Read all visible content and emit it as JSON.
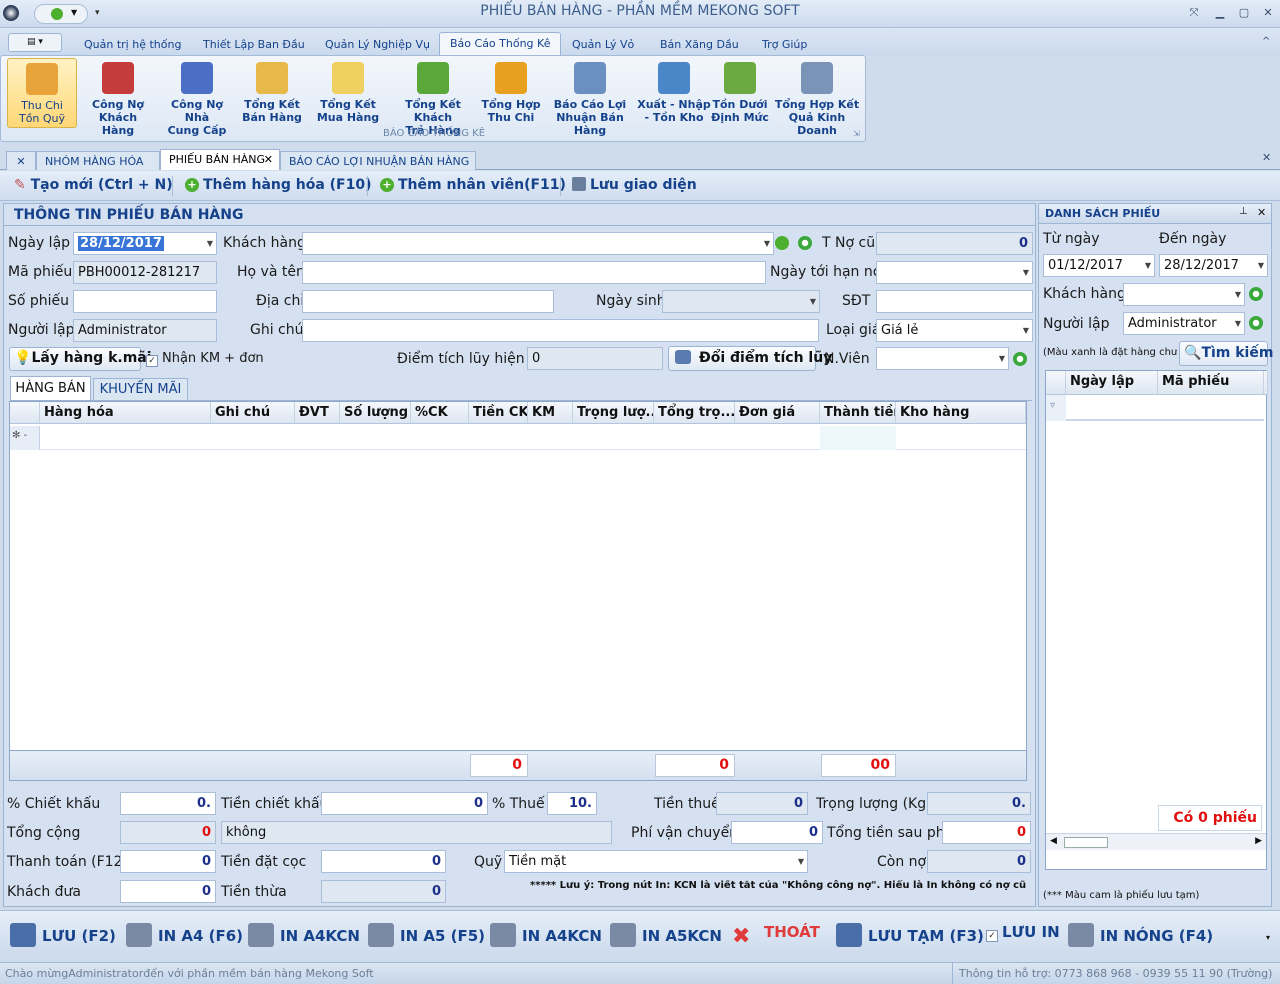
{
  "title": "PHIẾU BÁN HÀNG - PHẦN MỀM MEKONG SOFT",
  "menu": [
    "Quản trị hệ thống",
    "Thiết Lập Ban Đầu",
    "Quản Lý Nghiệp Vụ",
    "Báo Cáo Thống Kê",
    "Quản Lý Vỏ",
    "Bán Xăng Dầu",
    "Trợ Giúp"
  ],
  "ribbon": {
    "buttons": [
      {
        "line1": "Thu Chi",
        "line2": "Tồn Quỹ",
        "color": "#e8a33a"
      },
      {
        "line1": "Công Nợ",
        "line2": "Khách Hàng",
        "color": "#c63b3b"
      },
      {
        "line1": "Công Nợ Nhà",
        "line2": "Cung Cấp",
        "color": "#4b6fc4"
      },
      {
        "line1": "Tổng Kết",
        "line2": "Bán Hàng",
        "color": "#e7b84a"
      },
      {
        "line1": "Tổng Kết",
        "line2": "Mua Hàng",
        "color": "#f0d060"
      },
      {
        "line1": "Tổng Kết Khách",
        "line2": "Trả Hàng",
        "color": "#5aa83a"
      },
      {
        "line1": "Tổng Hợp",
        "line2": "Thu Chi",
        "color": "#e8a020"
      },
      {
        "line1": "Báo Cáo Lợi",
        "line2": "Nhuận Bán Hàng",
        "color": "#6a8fc0"
      },
      {
        "line1": "Xuất - Nhập",
        "line2": "- Tồn Kho",
        "color": "#4a86c8"
      },
      {
        "line1": "Tồn Dưới",
        "line2": "Định Mức",
        "color": "#6aaa40"
      },
      {
        "line1": "Tổng Hợp Kết",
        "line2": "Quả Kinh Doanh",
        "color": "#7a94b8"
      }
    ],
    "group_label": "BÁO CÁO THỐNG KÊ"
  },
  "doc_tabs": [
    "NHÓM HÀNG HÓA",
    "PHIẾU BÁN HÀNG",
    "BÁO CÁO LỢI NHUẬN BÁN HÀNG"
  ],
  "toolbar": {
    "new": "Tạo mới (Ctrl + N)",
    "add_goods": "Thêm hàng hóa (F10)",
    "add_staff": "Thêm nhân viên(F11)",
    "save_layout": "Lưu giao diện"
  },
  "form": {
    "section_title": "THÔNG TIN PHIẾU BÁN HÀNG",
    "date_label": "Ngày lập",
    "date_value": "28/12/2017",
    "customer_label": "Khách hàng",
    "customer_value": "",
    "old_debt_label": "T Nợ cũ",
    "old_debt_value": "0",
    "code_label": "Mã phiếu",
    "code_value": "PBH00012-281217",
    "name_label": "Họ và tên",
    "name_value": "",
    "due_label": "Ngày tới hạn nợ",
    "due_value": "",
    "number_label": "Số phiếu",
    "number_value": "",
    "address_label": "Địa chỉ",
    "address_value": "",
    "birth_label": "Ngày sinh",
    "birth_value": "",
    "phone_label": "SĐT",
    "phone_value": "",
    "creator_label": "Người lập",
    "creator_value": "Administrator",
    "note_label": "Ghi chú",
    "note_value": "",
    "price_label": "Loại giá",
    "price_value": "Giá lẻ",
    "fetch_btn": "Lấy hàng k.mãi",
    "promo_check": "Nhận KM + đơn",
    "points_label": "Điểm tích lũy hiện tại",
    "points_value": "0",
    "redeem_btn": "Đổi điểm tích lũy",
    "staff_label": "N.Viên",
    "staff_value": ""
  },
  "sub_tabs": [
    "HÀNG BÁN",
    "KHUYẾN MÃI"
  ],
  "grid": {
    "columns": [
      "Hàng hóa",
      "Ghi chú",
      "ĐVT",
      "Số lượng",
      "%CK",
      "Tiền CK",
      "KM",
      "Trọng lượ...",
      "Tổng trọ...",
      "Đơn giá",
      "Thành tiền",
      "Kho hàng"
    ],
    "new_row_marker": "✻ -",
    "footer": {
      "discount_total": "0",
      "weight_total": "0",
      "amount_total": "00"
    }
  },
  "totals": {
    "discount_pct_label": "% Chiết khấu",
    "discount_pct": "0.",
    "discount_amt_label": "Tiền chiết khấu",
    "discount_amt": "0",
    "tax_pct_label": "% Thuế",
    "tax_pct": "10.",
    "tax_amt_label": "Tiền thuế",
    "tax_amt": "0",
    "weight_label": "Trọng lượng (Kg)",
    "weight": "0.",
    "total_label": "Tổng cộng",
    "total": "0",
    "total_words": "không",
    "shipping_label": "Phí vận chuyển",
    "shipping": "0",
    "after_fee_label": "Tổng tiền sau phí",
    "after_fee": "0",
    "paid_label": "Thanh toán (F12)",
    "paid": "0",
    "deposit_label": "Tiền đặt cọc",
    "deposit": "0",
    "fund_label": "Quỹ",
    "fund": "Tiền mặt",
    "remaining_label": "Còn nợ",
    "remaining": "0",
    "given_label": "Khách đưa",
    "given": "0",
    "change_label": "Tiền thừa",
    "change": "0",
    "note": "***** Lưu ý: Trong nút In: KCN là viết tắt của \"Không công nợ\". Hiểu là In không có nợ cũ"
  },
  "right": {
    "title": "DANH SÁCH PHIẾU",
    "from_label": "Từ ngày",
    "from_value": "01/12/2017",
    "to_label": "Đến ngày",
    "to_value": "28/12/2017",
    "customer_label": "Khách hàng",
    "customer_value": "",
    "creator_label": "Người lập",
    "creator_value": "Administrator",
    "hint": "(Màu xanh là đặt hàng chưa",
    "search_btn": "Tìm kiếm",
    "columns": [
      "Ngày lập",
      "Mã phiếu"
    ],
    "count": "Có 0 phiếu",
    "footnote": "(*** Màu cam là phiếu lưu tạm)"
  },
  "bottom": [
    {
      "label": "LƯU (F2)",
      "name": "save-button",
      "color": "#4a6fa8"
    },
    {
      "label": "IN A4 (F6)",
      "name": "print-a4-button",
      "color": "#7a8aa6"
    },
    {
      "label": "IN A4KCN",
      "name": "print-a4kcn-button",
      "color": "#7a8aa6"
    },
    {
      "label": "IN A5 (F5)",
      "name": "print-a5-button",
      "color": "#7a8aa6"
    },
    {
      "label": "IN A4KCN",
      "name": "print-a4kcn-button-2",
      "color": "#7a8aa6"
    },
    {
      "label": "IN A5KCN",
      "name": "print-a5kcn-button",
      "color": "#7a8aa6"
    },
    {
      "label": "THOÁT",
      "name": "exit-button",
      "color": "#e03a3a"
    },
    {
      "label": "LƯU TẠM (F3)",
      "name": "save-draft-button",
      "color": "#4a6fa8"
    },
    {
      "label": "LƯU IN",
      "name": "save-print-check",
      "color": ""
    },
    {
      "label": "IN NÓNG (F4)",
      "name": "quick-print-button",
      "color": "#7a8aa6"
    }
  ],
  "status": {
    "left": "Chào mừngAdministratorđến với phần mềm bán hàng Mekong Soft",
    "right": "Thông tin hỗ trợ: 0773 868 968 - 0939 55 11 90 (Trường)"
  }
}
